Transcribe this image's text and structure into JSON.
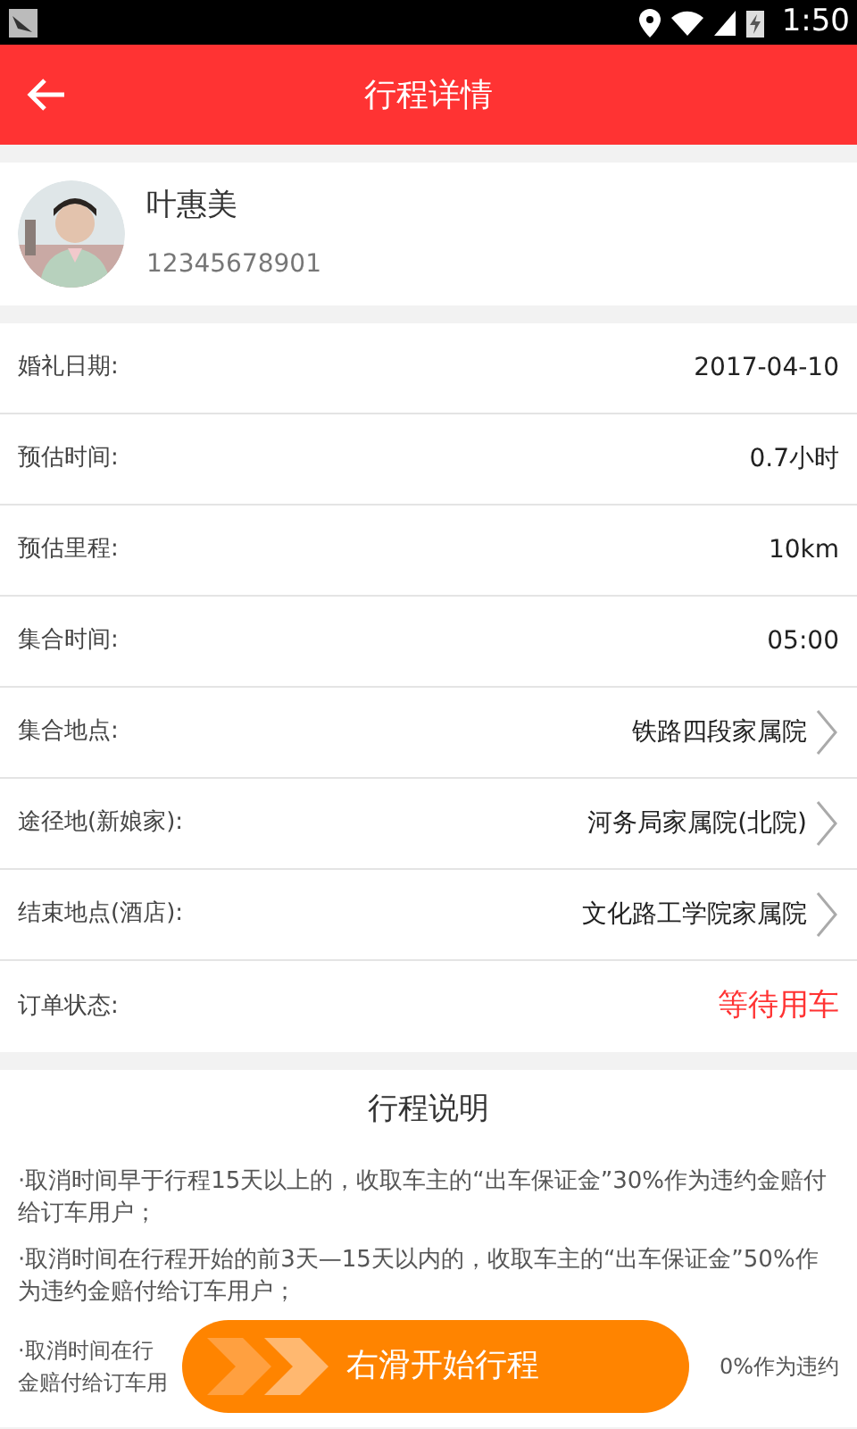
{
  "status_bar": {
    "time": "1:50"
  },
  "header": {
    "title": "行程详情"
  },
  "user": {
    "name": "叶惠美",
    "phone": "12345678901"
  },
  "details": [
    {
      "label": "婚礼日期:",
      "value": "2017-04-10",
      "kind": "plain"
    },
    {
      "label": "预估时间:",
      "value": "0.7小时",
      "kind": "plain"
    },
    {
      "label": "预估里程:",
      "value": "10km",
      "kind": "plain"
    },
    {
      "label": "集合时间:",
      "value": "05:00",
      "kind": "plain"
    },
    {
      "label": "集合地点:",
      "value": "铁路四段家属院",
      "kind": "link"
    },
    {
      "label": "途径地(新娘家):",
      "value": "河务局家属院(北院)",
      "kind": "link"
    },
    {
      "label": "结束地点(酒店):",
      "value": "文化路工学院家属院",
      "kind": "link"
    },
    {
      "label": "订单状态:",
      "value": "等待用车",
      "kind": "status"
    }
  ],
  "notes": {
    "title": "行程说明",
    "paragraphs": [
      "·取消时间早于行程15天以上的，收取车主的“出车保证金”30%作为违约金赔付给订车用户；",
      "·取消时间在行程开始的前3天—15天以内的，收取车主的“出车保证金”50%作为违约金赔付给订车用户；"
    ],
    "partial": {
      "left": [
        "·取消时间在行",
        "金赔付给订车用"
      ],
      "right": [
        "0%作为违约"
      ]
    }
  },
  "slide_button": {
    "label": "右滑开始行程"
  }
}
